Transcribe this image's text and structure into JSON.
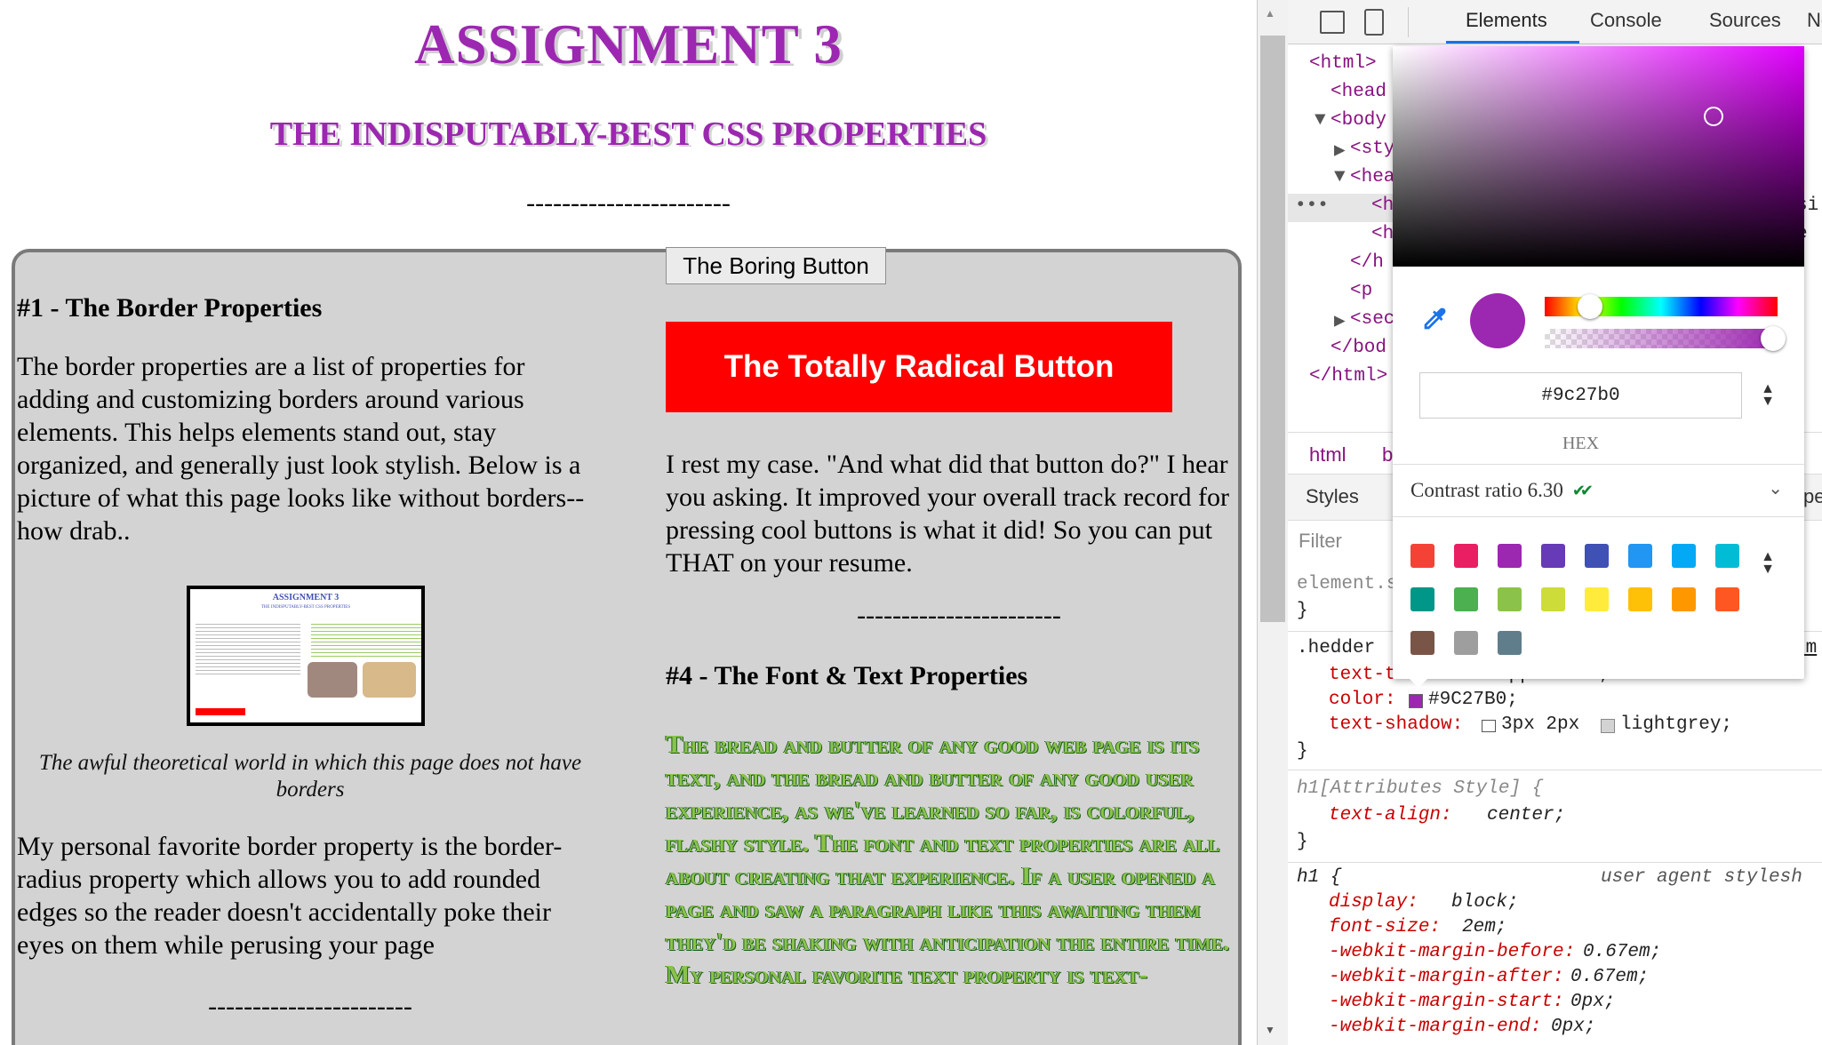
{
  "page": {
    "heading": "Assignment 3",
    "subheading": "The Indisputably-Best CSS Properties",
    "divider": "-----------------------",
    "left": {
      "title": "#1 - The Border Properties",
      "para1": "The border properties are a list of properties for adding and customizing borders around various elements. This helps elements stand out, stay organized, and generally just look stylish. Below is a picture of what this page looks like without borders--how drab..",
      "caption": "The awful theoretical world in which this page does not have borders",
      "para2": "My personal favorite border property is the border-radius property which allows you to add rounded edges so the reader doesn't accidentally poke their eyes on them while perusing your page",
      "divider": "-----------------------"
    },
    "right": {
      "boring_button": "The Boring Button",
      "radical_button": "The Totally Radical Button",
      "para": "I rest my case. \"And what did that button do?\" I hear you asking. It improved your overall track record for pressing cool buttons is what it did! So you can put THAT on your resume.",
      "divider": "-----------------------",
      "title": "#4 - The Font & Text Properties",
      "fancy_text": "The bread and butter of any good web page is its text, and the bread and butter of any good user experience, as we've learned so far, is colorful, flashy style. The font and text properties are all about creating that experience. If a user opened a page and saw a paragraph like this awaiting them they'd be shaking with anticipation the entire time. My personal favorite text property is text-"
    }
  },
  "devtools": {
    "tabs": [
      "Elements",
      "Console",
      "Sources",
      "Net"
    ],
    "tree": [
      "<html>",
      "<head",
      "<body",
      "<sty",
      "<hea",
      "<h",
      "<h",
      "</h",
      "<p",
      "<sec",
      "</bod",
      "</html>"
    ],
    "breadcrumb": [
      "html",
      "bo"
    ],
    "styles_tab": "Styles",
    "styles_tab_right": "pe",
    "filter_placeholder": "Filter",
    "element_style": "element.s",
    "brace_close": "}",
    "rule_selector": ".hedder",
    "rule_source": "tm",
    "rule_line1": "text-t…",
    "rule_line1_val": "uppercase;",
    "color_prop": "color:",
    "color_val": "#9C27B0;",
    "shadow_prop": "text-shadow:",
    "shadow_val1": "3px 2px",
    "shadow_val2": "lightgrey;",
    "attr_selector": "h1[Attributes Style] {",
    "attr_prop": "text-align:",
    "attr_val": "center;",
    "ua_selector": "h1 {",
    "ua_source": "user agent stylesh",
    "ua_rules": [
      {
        "prop": "display:",
        "val": "block;"
      },
      {
        "prop": "font-size:",
        "val": "2em;"
      },
      {
        "prop": "-webkit-margin-before:",
        "val": "0.67em;"
      },
      {
        "prop": "-webkit-margin-after:",
        "val": "0.67em;"
      },
      {
        "prop": "-webkit-margin-start:",
        "val": "0px;"
      },
      {
        "prop": "-webkit-margin-end:",
        "val": "0px;"
      }
    ],
    "side_text1": "si",
    "side_text2": "e"
  },
  "picker": {
    "hex_value": "#9c27b0",
    "hex_label": "HEX",
    "contrast_label": "Contrast ratio 6.30",
    "check": "✔✔",
    "palette": [
      "#f44336",
      "#e91e63",
      "#9c27b0",
      "#673ab7",
      "#3f51b5",
      "#2196f3",
      "#03a9f4",
      "#00bcd4",
      "#009688",
      "#4caf50",
      "#8bc34a",
      "#cddc39",
      "#ffeb3b",
      "#ffc107",
      "#ff9800",
      "#ff5722",
      "#795548",
      "#9e9e9e",
      "#607d8b"
    ],
    "current_color": "#9c27b0",
    "alpha": 1.0
  }
}
